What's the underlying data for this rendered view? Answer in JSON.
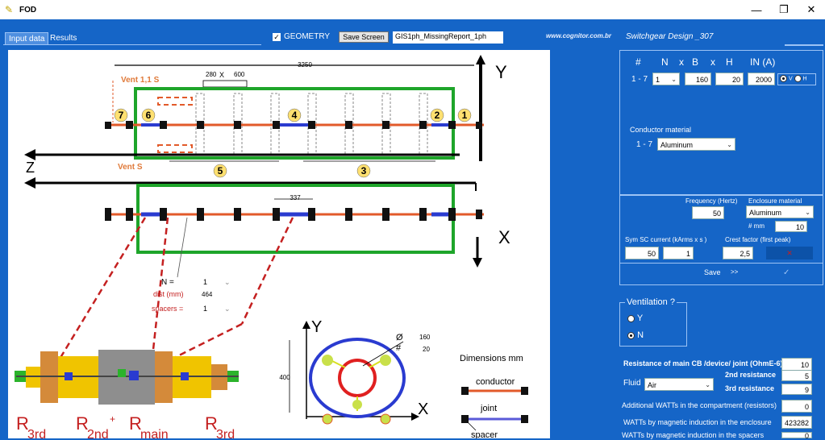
{
  "window": {
    "title": "FOD",
    "min_icon": "minimize-icon",
    "max_icon": "restore-icon",
    "close_icon": "close-icon"
  },
  "tabs": [
    {
      "label": "Input data",
      "active": true
    },
    {
      "label": "Results",
      "active": false
    }
  ],
  "geometry": {
    "label": "GEOMETRY",
    "checked": true
  },
  "save_screen": "Save Screen",
  "filename": "GIS1ph_MissingReport_1ph",
  "website": "www.cognitor.com.br",
  "design_title": "Switchgear Design _307",
  "drawing": {
    "dim_3250": "3250",
    "dim_280": "280",
    "dim_x": "X",
    "dim_600": "600",
    "vent_top": "Vent 1,1 S",
    "vent_bottom": "Vent S",
    "axis_y": "Y",
    "axis_z": "Z",
    "axis_x": "X",
    "conductors": [
      "1",
      "2",
      "3",
      "4",
      "5",
      "6",
      "7"
    ],
    "dim_337": "337",
    "n_label": "N =",
    "n_value": "1",
    "dist_label": "dist (mm)",
    "dist_value": "464",
    "spacers_label": "spacers =",
    "spacers_value": "1",
    "cs_axis_y": "Y",
    "cs_axis_x": "X",
    "cs_dim_400": "400",
    "cs_phi": "Ø",
    "cs_phi_value": "160",
    "cs_hash": "#",
    "cs_hash_value": "20",
    "dims_title": "Dimensions  mm",
    "legend_conductor": "conductor",
    "legend_joint": "joint",
    "legend_spacer": "spacer",
    "r_labels": [
      "R",
      "3rd",
      "R",
      "2nd",
      "+",
      "R",
      "main",
      "R",
      "3rd"
    ]
  },
  "table_header": {
    "num": "#",
    "n": "N",
    "x1": "x",
    "b": "B",
    "x2": "x",
    "h": "H",
    "in": "IN (A)"
  },
  "row": {
    "range": "1 - 7",
    "n": "1",
    "b": "160",
    "h": "20",
    "in": "2000",
    "v": "V",
    "hz": "H"
  },
  "conductor_material": {
    "label": "Conductor material",
    "range": "1 - 7",
    "value": "Aluminum"
  },
  "frequency": {
    "label": "Frequency (Hertz)",
    "value": "50"
  },
  "enclosure_material": {
    "label": "Enclosure material",
    "value": "Aluminum",
    "mm_label": "#  mm",
    "mm_value": "10"
  },
  "sym_sc": {
    "label": "Sym SC current (kArms x s )",
    "value1": "50",
    "value2": "1"
  },
  "crest": {
    "label": "Crest factor (first peak)",
    "value": "2,5"
  },
  "save_row": {
    "label": "Save",
    "arrows": ">>",
    "check": "✓"
  },
  "ventilation": {
    "label": "Ventilation ?",
    "yes": "Y",
    "no": "N",
    "selected": "N"
  },
  "resistance": {
    "label": "Resistance of main CB /device/ joint (OhmE-6)",
    "value": "10"
  },
  "fluid": {
    "label": "Fluid",
    "value": "Air"
  },
  "second_res": {
    "label": "2nd resistance",
    "value": "5"
  },
  "third_res": {
    "label": "3rd resistance",
    "value": "9"
  },
  "add_watts": {
    "label": "Additional WATTs in the compartment (resistors)",
    "value": "0"
  },
  "watts_enclosure": {
    "label": "WATTs by  magnetic induction in the enclosure",
    "value": "423282"
  },
  "watts_spacers": {
    "label": "WATTs by magnetic induction in the spacers",
    "value": "0"
  }
}
